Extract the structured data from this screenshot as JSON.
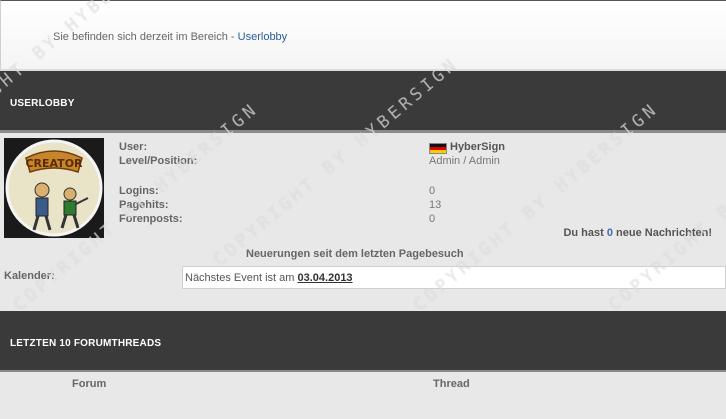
{
  "breadcrumb": {
    "prefix": "Sie befinden sich derzeit im Bereich - ",
    "link": "Userlobby"
  },
  "section_userlobby": {
    "title": "USERLOBBY"
  },
  "profile": {
    "user_label": "User:",
    "user_value": "HyberSign",
    "level_label": "Level/Position:",
    "level_value": "Admin / Admin",
    "logins_label": "Logins:",
    "logins_value": "0",
    "pagehits_label": "Pagehits:",
    "pagehits_value": "13",
    "forenposts_label": "Forenposts:",
    "forenposts_value": "0",
    "avatar_text": "CREATOR"
  },
  "messages": {
    "prefix": "Du hast ",
    "count": "0",
    "suffix": " neue Nachrichten!"
  },
  "changes_text": "Neuerungen seit dem letzten Pagebesuch",
  "calendar": {
    "label": "Kalender:",
    "event_prefix": "Nächstes Event ist am ",
    "event_date": "03.04.2013"
  },
  "section_threads": {
    "title": "LETZTEN 10 FORUMTHREADS"
  },
  "threads_columns": {
    "forum": "Forum",
    "thread": "Thread"
  },
  "watermark": {
    "text": "COPYRIGHT BY HYBERSIGN"
  },
  "colors": {
    "header_bg": "#3a3a3a",
    "link": "#2a5c9a",
    "count": "#3a6bb5"
  }
}
